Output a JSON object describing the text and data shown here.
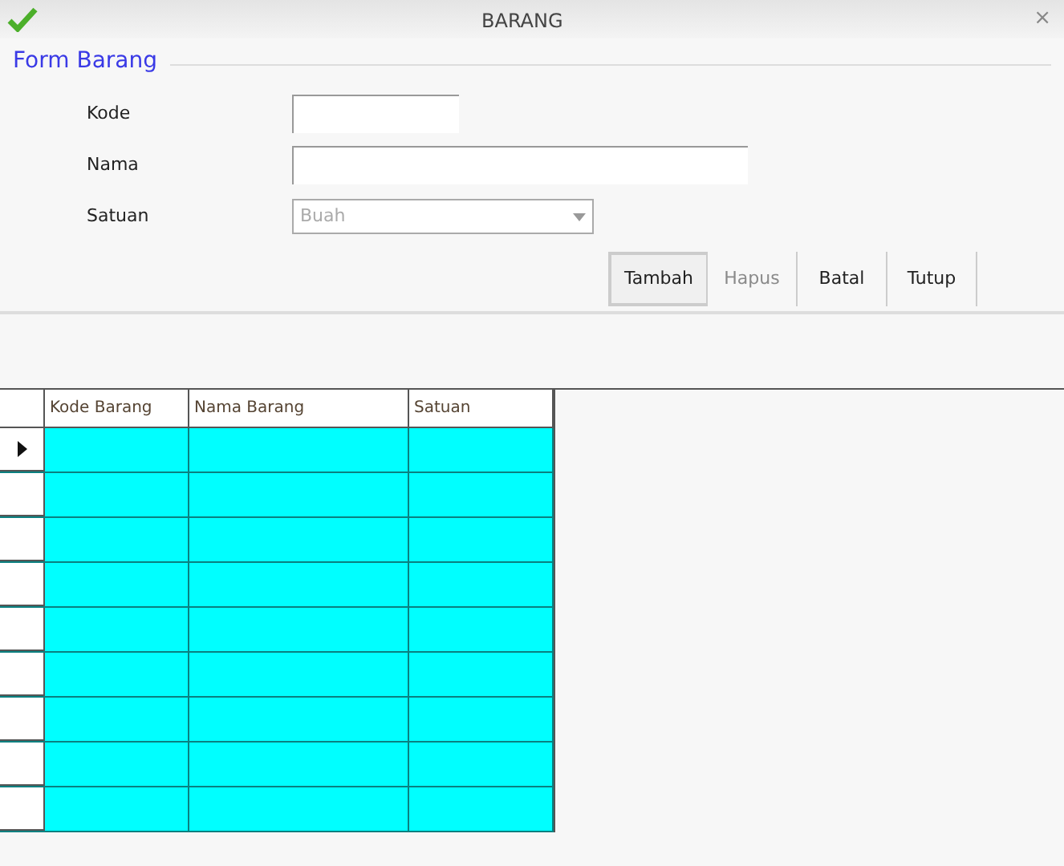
{
  "window": {
    "title": "BARANG",
    "close": "×"
  },
  "form": {
    "title": "Form Barang",
    "fields": [
      {
        "label": "Kode",
        "kind": "text"
      },
      {
        "label": "Nama",
        "kind": "text"
      },
      {
        "label": "Satuan",
        "kind": "combo",
        "value": "Buah",
        "disabled": true
      }
    ]
  },
  "buttons": [
    {
      "label": "Tambah",
      "disabled": false,
      "focused": true
    },
    {
      "label": "Hapus",
      "disabled": true,
      "focused": false
    },
    {
      "label": "Batal",
      "disabled": false,
      "focused": false
    },
    {
      "label": "Tutup",
      "disabled": false,
      "focused": false
    }
  ],
  "table": {
    "columns": [
      "Kode Barang",
      "Nama Barang",
      "Satuan"
    ],
    "rows": [
      {
        "selected": true
      },
      {
        "selected": false
      },
      {
        "selected": false
      },
      {
        "selected": false
      },
      {
        "selected": false
      },
      {
        "selected": false
      },
      {
        "selected": false
      },
      {
        "selected": false
      },
      {
        "selected": false
      }
    ]
  }
}
